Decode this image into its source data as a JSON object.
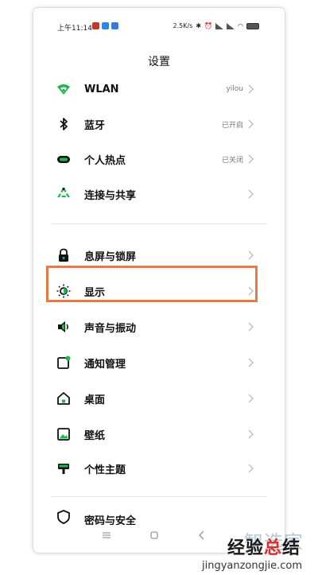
{
  "statusbar": {
    "time": "上午11:14",
    "speed": "2.5K/s"
  },
  "page": {
    "title": "设置"
  },
  "items": [
    {
      "label": "WLAN",
      "value": "yilou",
      "icon": "wifi-icon"
    },
    {
      "label": "蓝牙",
      "value": "已开启",
      "icon": "bluetooth-icon"
    },
    {
      "label": "个人热点",
      "value": "已关闭",
      "icon": "hotspot-icon"
    },
    {
      "label": "连接与共享",
      "value": "",
      "icon": "connection-share-icon"
    },
    {
      "label": "息屏与锁屏",
      "value": "",
      "icon": "lock-icon"
    },
    {
      "label": "显示",
      "value": "",
      "icon": "brightness-icon"
    },
    {
      "label": "声音与振动",
      "value": "",
      "icon": "speaker-icon"
    },
    {
      "label": "通知管理",
      "value": "",
      "icon": "notification-icon"
    },
    {
      "label": "桌面",
      "value": "",
      "icon": "home-icon"
    },
    {
      "label": "壁纸",
      "value": "",
      "icon": "wallpaper-icon"
    },
    {
      "label": "个性主题",
      "value": "",
      "icon": "theme-icon"
    },
    {
      "label": "密码与安全",
      "value": "",
      "icon": "shield-icon"
    }
  ],
  "watermark": {
    "logo": "智选家",
    "title_black_1": "经验",
    "title_red": "总",
    "title_black_2": "结",
    "url": "jingyanzongjie.com"
  },
  "colors": {
    "accent": "#1fb84e",
    "highlight": "#e57a45"
  }
}
